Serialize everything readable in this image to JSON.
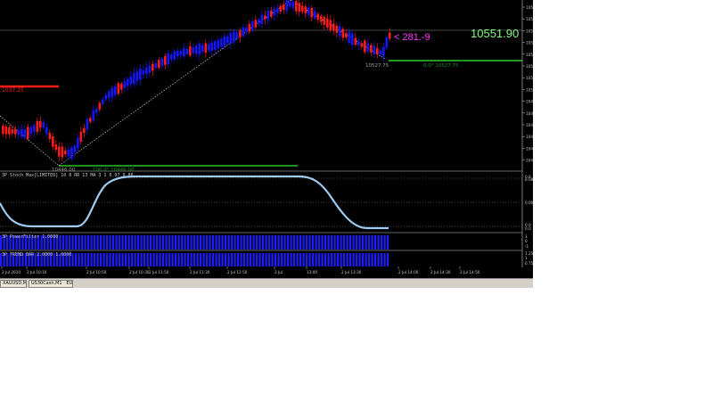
{
  "main_chart": {
    "bid_price": "10551.90",
    "pips_label": "< 281.-9",
    "low_price_label": "10527.75",
    "fib_zero_label": "0.0° 10527.75",
    "resistance_label": "1037.25",
    "swing_low_label": "10446.00",
    "fib_hundred_label": "100.0° 10446.00",
    "colors": {
      "bull": "#1414ff",
      "bear": "#ff1a1a",
      "fib": "#1f8f1f",
      "support": "#2ecc2e",
      "resistance": "#ff1a1a",
      "bid": "#7fff7f",
      "pips": "#ff33ff",
      "line": "#9aa09a"
    }
  },
  "price_axis": [
    "10575",
    "10565",
    "10555",
    "10545",
    "10535",
    "10525",
    "10515",
    "10505",
    "10495",
    "10485",
    "10475",
    "10465",
    "10455",
    "10445"
  ],
  "subwindow1": {
    "label": "3P Stoch Max[LIMITED] 10 8 RR 13 MA 3 1 0.97 0.88",
    "levels": [
      "0.8",
      "8.08",
      "0.00",
      "0.0",
      "0.0"
    ],
    "curve_color": "#9ecbf2"
  },
  "subwindow2": {
    "label": "3P PowerFilter 1.0000",
    "levels": [
      "1",
      "0",
      "-1"
    ]
  },
  "subwindow3": {
    "label": "3P TREND BAR 2.0000 1.0000",
    "levels": [
      "1.25",
      "1",
      "0.75"
    ]
  },
  "time_axis": [
    "2 Jul 2010",
    "2 Jul 10:10",
    "2 Jul 10:50",
    "2 Jul 10:30",
    "2 Jul 11:50",
    "2 Jul 11:30",
    "2 Jul 12:50",
    "2 Jul",
    "13:00",
    "2 Jul 13:30",
    "2 Jul 14:00",
    "2 Jul 14:30",
    "2 Jul 14:50"
  ],
  "tabs": [
    "XAUUSD,M1",
    "US30Cash,M1 · EURUSD"
  ]
}
